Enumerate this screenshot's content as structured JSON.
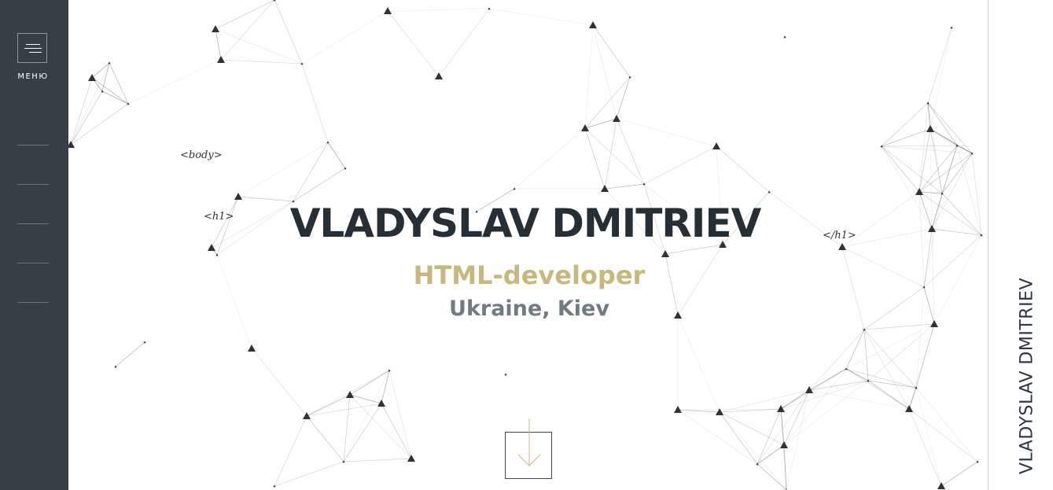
{
  "sidebar": {
    "menu_label": "МЕНЮ"
  },
  "hero": {
    "name": "VLADYSLAV DMITRIEV",
    "role": "HTML-developer",
    "location": "Ukraine, Kiev",
    "body_tag": "<body>",
    "h1_open_tag": "<h1>",
    "h1_close_tag": "</h1>"
  },
  "side_name": "VLADYSLAV DMITRIEV",
  "colors": {
    "sidebar_bg": "#363f45",
    "title": "#262f35",
    "role": "#c9b87c",
    "location": "#707b82"
  },
  "icons": {
    "menu": "hamburger-icon",
    "scroll": "arrow-down-icon"
  }
}
